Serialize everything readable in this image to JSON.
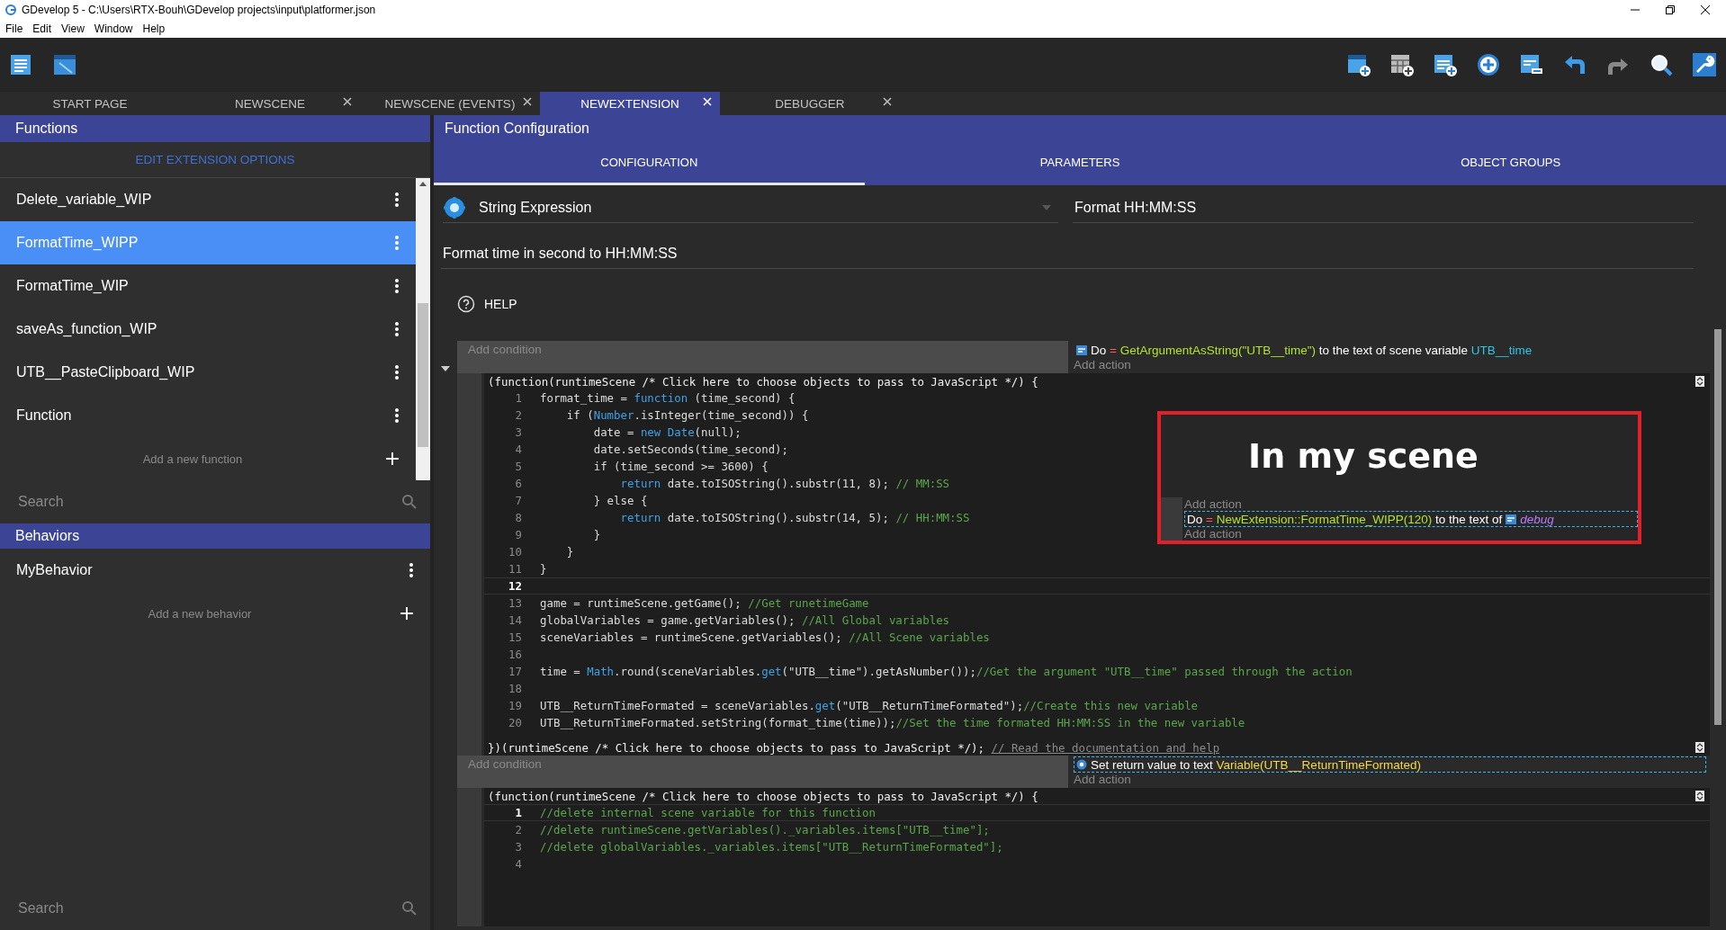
{
  "window": {
    "title": "GDevelop 5 - C:\\Users\\RTX-Bouh\\GDevelop projects\\input\\platformer.json"
  },
  "menu": [
    "File",
    "Edit",
    "View",
    "Window",
    "Help"
  ],
  "tabs": [
    {
      "label": "START PAGE",
      "selected": false,
      "closable": false
    },
    {
      "label": "NEWSCENE",
      "selected": false,
      "closable": true
    },
    {
      "label": "NEWSCENE (EVENTS)",
      "selected": false,
      "closable": true
    },
    {
      "label": "NEWEXTENSION",
      "selected": true,
      "closable": true
    },
    {
      "label": "DEBUGGER",
      "selected": false,
      "closable": true
    }
  ],
  "functions_panel": {
    "title": "Functions",
    "edit_options": "EDIT EXTENSION OPTIONS",
    "items": [
      {
        "label": "Delete_variable_WIP",
        "selected": false
      },
      {
        "label": "FormatTime_WIPP",
        "selected": true
      },
      {
        "label": "FormatTime_WIP",
        "selected": false
      },
      {
        "label": "saveAs_function_WIP",
        "selected": false
      },
      {
        "label": "UTB__PasteClipboard_WIP",
        "selected": false
      },
      {
        "label": "Function",
        "selected": false
      }
    ],
    "add_label": "Add a new function",
    "search_placeholder": "Search"
  },
  "behaviors_panel": {
    "title": "Behaviors",
    "items": [
      {
        "label": "MyBehavior",
        "selected": false
      }
    ],
    "add_label": "Add a new behavior"
  },
  "bottom_search": {
    "placeholder": "Search"
  },
  "config": {
    "title": "Function Configuration",
    "tabs": [
      {
        "label": "CONFIGURATION",
        "selected": true
      },
      {
        "label": "PARAMETERS",
        "selected": false
      },
      {
        "label": "OBJECT GROUPS",
        "selected": false
      }
    ],
    "function_type": "String Expression",
    "full_name": "Format HH:MM:SS",
    "description": "Format time in second to HH:MM:SS",
    "help": "HELP"
  },
  "events": [
    {
      "add_condition": "Add condition",
      "add_action": "Add action",
      "action": {
        "kind": "variable",
        "selected": false,
        "segments": [
          {
            "t": "Do",
            "kind": "text"
          },
          {
            "t": " = ",
            "kind": "op"
          },
          {
            "t": "GetArgumentAsString(\"UTB__time\")",
            "kind": "expr"
          },
          {
            "t": " to the text of scene variable ",
            "kind": "text"
          },
          {
            "t": "UTB__time",
            "kind": "var"
          }
        ]
      },
      "code": {
        "header": "(function(runtimeScene /* Click here to choose objects to pass to JavaScript */) {",
        "lines": [
          {
            "number": "1",
            "active": false,
            "segments": [
              {
                "t": "format_time = ",
                "kind": "plain"
              },
              {
                "t": "function",
                "kind": "kw"
              },
              {
                "t": " (time_second) {",
                "kind": "plain"
              }
            ]
          },
          {
            "number": "2",
            "active": false,
            "segments": [
              {
                "t": "    if (",
                "kind": "plain"
              },
              {
                "t": "Number",
                "kind": "kw"
              },
              {
                "t": ".isInteger(time_second)) {",
                "kind": "plain"
              }
            ]
          },
          {
            "number": "3",
            "active": false,
            "segments": [
              {
                "t": "        date = ",
                "kind": "plain"
              },
              {
                "t": "new ",
                "kind": "kw"
              },
              {
                "t": "Date",
                "kind": "kw"
              },
              {
                "t": "(null);",
                "kind": "plain"
              }
            ]
          },
          {
            "number": "4",
            "active": false,
            "segments": [
              {
                "t": "        date.setSeconds(time_second);",
                "kind": "plain"
              }
            ]
          },
          {
            "number": "5",
            "active": false,
            "segments": [
              {
                "t": "        if (time_second >= 3600) {",
                "kind": "plain"
              }
            ]
          },
          {
            "number": "6",
            "active": false,
            "segments": [
              {
                "t": "            return",
                "kind": "kw"
              },
              {
                "t": " date.toISOString().substr(11, 8); ",
                "kind": "plain"
              },
              {
                "t": "// MM:SS",
                "kind": "cm"
              }
            ]
          },
          {
            "number": "7",
            "active": false,
            "segments": [
              {
                "t": "        } else {",
                "kind": "plain"
              }
            ]
          },
          {
            "number": "8",
            "active": false,
            "segments": [
              {
                "t": "            return",
                "kind": "kw"
              },
              {
                "t": " date.toISOString().substr(14, 5); ",
                "kind": "plain"
              },
              {
                "t": "// HH:MM:SS",
                "kind": "cm"
              }
            ]
          },
          {
            "number": "9",
            "active": false,
            "segments": [
              {
                "t": "        }",
                "kind": "plain"
              }
            ]
          },
          {
            "number": "10",
            "active": false,
            "segments": [
              {
                "t": "    }",
                "kind": "plain"
              }
            ]
          },
          {
            "number": "11",
            "active": false,
            "segments": [
              {
                "t": "}",
                "kind": "plain"
              }
            ]
          },
          {
            "number": "12",
            "active": true
          },
          {
            "number": "13",
            "active": false,
            "segments": [
              {
                "t": "game = runtimeScene.getGame(); ",
                "kind": "plain"
              },
              {
                "t": "//Get runetimeGame",
                "kind": "cm"
              }
            ]
          },
          {
            "number": "14",
            "active": false,
            "segments": [
              {
                "t": "globalVariables = game.getVariables(); ",
                "kind": "plain"
              },
              {
                "t": "//All Global variables",
                "kind": "cm"
              }
            ]
          },
          {
            "number": "15",
            "active": false,
            "segments": [
              {
                "t": "sceneVariables = runtimeScene.getVariables(); ",
                "kind": "plain"
              },
              {
                "t": "//All Scene variables",
                "kind": "cm"
              }
            ]
          },
          {
            "number": "16",
            "active": false
          },
          {
            "number": "17",
            "active": false,
            "segments": [
              {
                "t": "time = ",
                "kind": "plain"
              },
              {
                "t": "Math",
                "kind": "kw"
              },
              {
                "t": ".round(sceneVariables.",
                "kind": "plain"
              },
              {
                "t": "get",
                "kind": "kw"
              },
              {
                "t": "(\"UTB__time\").getAsNumber());",
                "kind": "plain"
              },
              {
                "t": "//Get the argument \"UTB__time\" passed through the action",
                "kind": "cm"
              }
            ]
          },
          {
            "number": "18",
            "active": false
          },
          {
            "number": "19",
            "active": false,
            "segments": [
              {
                "t": "UTB__ReturnTimeFormated = sceneVariables.",
                "kind": "plain"
              },
              {
                "t": "get",
                "kind": "kw"
              },
              {
                "t": "(\"UTB__ReturnTimeFormated\");",
                "kind": "plain"
              },
              {
                "t": "//Create this new variable",
                "kind": "cm"
              }
            ]
          },
          {
            "number": "20",
            "active": false,
            "segments": [
              {
                "t": "UTB__ReturnTimeFormated.setString(format_time(time));",
                "kind": "plain"
              },
              {
                "t": "//Set the time formated HH:MM:SS in the new variable",
                "kind": "cm"
              }
            ]
          }
        ],
        "footer": "})(runtimeScene /* Click here to choose objects to pass to JavaScript */); ",
        "footer_link": "// Read the documentation and help"
      }
    },
    {
      "add_condition": "Add condition",
      "add_action": "Add action",
      "action": {
        "kind": "return",
        "selected": true,
        "segments": [
          {
            "t": "Set return value to text ",
            "kind": "text"
          },
          {
            "t": "Variable(UTB__ReturnTimeFormated)",
            "kind": "value"
          }
        ]
      },
      "code": {
        "header": "(function(runtimeScene /* Click here to choose objects to pass to JavaScript */) {",
        "lines": [
          {
            "number": "1",
            "active": true,
            "segments": [
              {
                "t": "//delete internal scene variable for this function",
                "kind": "cm"
              }
            ]
          },
          {
            "number": "2",
            "active": false,
            "segments": [
              {
                "t": "//delete runtimeScene.getVariables()._variables.items[\"UTB__time\"];",
                "kind": "cm"
              }
            ]
          },
          {
            "number": "3",
            "active": false,
            "segments": [
              {
                "t": "//delete globalVariables._variables.items[\"UTB__ReturnTimeFormated\"];",
                "kind": "cm"
              }
            ]
          },
          {
            "number": "4",
            "active": false
          }
        ]
      }
    }
  ],
  "overlay": {
    "title": "In my scene",
    "add_action_top": "Add action",
    "action": {
      "selected": true,
      "segments": [
        {
          "t": "Do",
          "kind": "text"
        },
        {
          "t": " = ",
          "kind": "op"
        },
        {
          "t": "NewExtension::FormatTime_WIPP(120)",
          "kind": "expr"
        },
        {
          "t": " to the text of",
          "kind": "text"
        }
      ],
      "object": "debug"
    },
    "add_action": "Add action"
  }
}
